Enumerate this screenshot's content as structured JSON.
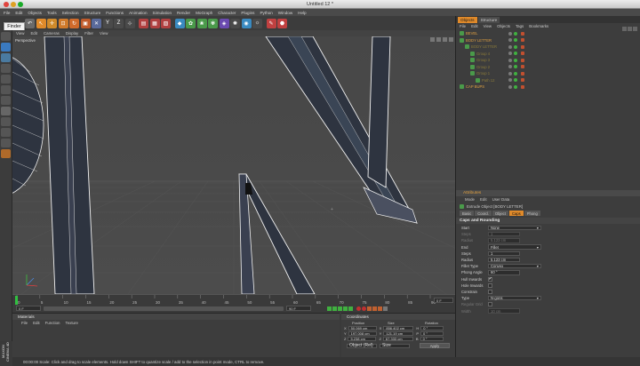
{
  "window": {
    "title": "Untitled 12 *"
  },
  "tooltip": {
    "text": "Finder"
  },
  "menubar": [
    "File",
    "Edit",
    "Objects",
    "Tools",
    "Selection",
    "Structure",
    "Functions",
    "Animation",
    "Simulation",
    "Render",
    "MoGraph",
    "Character",
    "Plugins",
    "Python",
    "Window",
    "Help"
  ],
  "viewport": {
    "menu": [
      "View",
      "Edit",
      "Cameras",
      "Display",
      "Filter",
      "View"
    ],
    "label": "Perspective"
  },
  "timeline": {
    "ticks": [
      "0",
      "5",
      "10",
      "15",
      "20",
      "25",
      "30",
      "35",
      "40",
      "45",
      "50",
      "55",
      "60",
      "65",
      "70",
      "75",
      "80",
      "85",
      "90"
    ],
    "current_frame": "0 F",
    "start_field": "0 F",
    "end_field": "90 F"
  },
  "materials": {
    "title": "Materials",
    "menu": [
      "File",
      "Edit",
      "Function",
      "Texture"
    ]
  },
  "coordinates": {
    "title": "Coordinates",
    "headers": [
      "Position",
      "Size",
      "Rotation"
    ],
    "rows": [
      {
        "axis": "X",
        "pos": "50.069 cm",
        "size_axis": "X",
        "size": "856.402 cm",
        "rot_axis": "H",
        "rot": "0 °"
      },
      {
        "axis": "Y",
        "pos": "197.008 cm",
        "size_axis": "Y",
        "size": "121.19 cm",
        "rot_axis": "P",
        "rot": "0 °"
      },
      {
        "axis": "Z",
        "pos": "5.238 cm",
        "size_axis": "Z",
        "size": "67.333 cm",
        "rot_axis": "B",
        "rot": "0 °"
      }
    ],
    "mode_select": "Object (Rel)",
    "size_select": "Size",
    "apply_label": "Apply"
  },
  "status": {
    "text": "00:00:00    Scale: Click and drag to scale elements. Hold down SHIFT to quantize scale / add to the selection in point mode, CTRL to remove."
  },
  "logo": {
    "text": "MAXON CINEMA 4D"
  },
  "objects_panel": {
    "tabs": [
      "Objects",
      "Structure"
    ],
    "menu": [
      "File",
      "Edit",
      "View",
      "Objects",
      "Tags",
      "Bookmarks"
    ],
    "items": [
      {
        "name": "BEVEL",
        "indent": 0,
        "color": "#e0a040"
      },
      {
        "name": "BODY LETTER",
        "indent": 0,
        "color": "#e0a040"
      },
      {
        "name": "BODY LETTER",
        "indent": 1,
        "color": "#8a7a3a"
      },
      {
        "name": "Group 4",
        "indent": 2,
        "color": "#8a7a3a"
      },
      {
        "name": "Group 3",
        "indent": 2,
        "color": "#8a7a3a"
      },
      {
        "name": "Group 2",
        "indent": 2,
        "color": "#8a7a3a"
      },
      {
        "name": "Group 1",
        "indent": 2,
        "color": "#8a7a3a"
      },
      {
        "name": "Path 12",
        "indent": 3,
        "color": "#8a7a3a"
      },
      {
        "name": "CAP BUPS",
        "indent": 0,
        "color": "#e0a040"
      }
    ]
  },
  "attributes_panel": {
    "title": "Attributes",
    "menu": [
      "Mode",
      "Edit",
      "User Data"
    ],
    "object_title": "Extrude Object [BODY LETTER]",
    "tabs": [
      "Basic",
      "Coord.",
      "Object",
      "Caps",
      "Phong"
    ],
    "active_tab": "Caps",
    "section": "Caps and Rounding",
    "rows": [
      {
        "label": "Start",
        "value": "None",
        "type": "select",
        "dim": false
      },
      {
        "label": "Steps",
        "value": "1",
        "type": "field",
        "dim": true
      },
      {
        "label": "Radius",
        "value": "5.123 cm",
        "type": "field",
        "dim": true
      },
      {
        "label": "End",
        "value": "Fillet",
        "type": "select",
        "dim": false
      },
      {
        "label": "Steps",
        "value": "1",
        "type": "field",
        "dim": false
      },
      {
        "label": "Radius",
        "value": "5.123 cm",
        "type": "field",
        "dim": false
      },
      {
        "label": "Fillet Type",
        "value": "Convex",
        "type": "select",
        "dim": false
      },
      {
        "label": "Phong Angle",
        "value": "60 °",
        "type": "field",
        "dim": false
      },
      {
        "label": "Hull Inwards",
        "value": "✔",
        "type": "check",
        "dim": false
      },
      {
        "label": "Hole Inwards",
        "value": "",
        "type": "check",
        "dim": false
      },
      {
        "label": "Constrain",
        "value": "",
        "type": "check",
        "dim": false
      },
      {
        "label": "Type",
        "value": "N-gons",
        "type": "select",
        "dim": false
      },
      {
        "label": "Regular Grid",
        "value": "",
        "type": "check",
        "dim": true
      },
      {
        "label": "Width",
        "value": "10 cm",
        "type": "field",
        "dim": true
      }
    ]
  },
  "colors": {
    "accent": "#e08a2a",
    "viewport_bg": "#474747",
    "wire": "#f0f0f0",
    "body_fill": "#2e3440"
  }
}
